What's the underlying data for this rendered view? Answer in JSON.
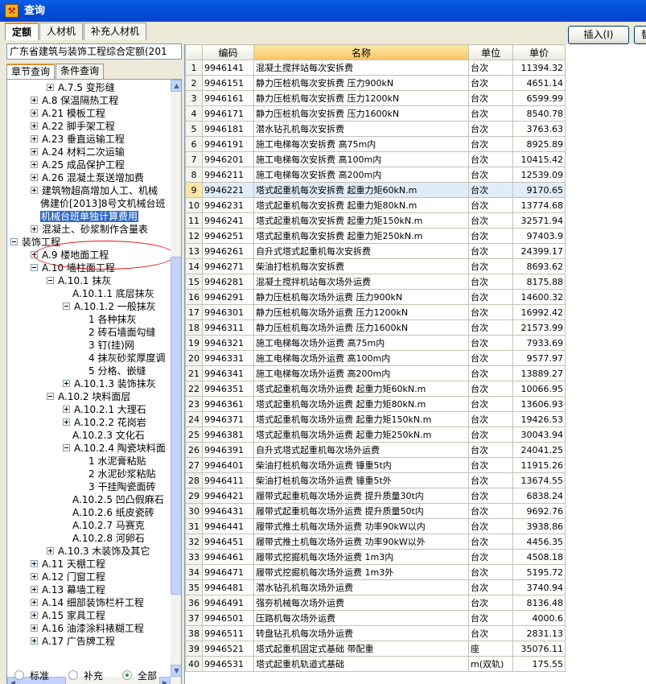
{
  "window": {
    "title": "查询"
  },
  "tabs": [
    "定额",
    "人材机",
    "补充人材机"
  ],
  "buttons": {
    "insert": "插入(I)",
    "replace": "替"
  },
  "left": {
    "quota_lib": "广东省建筑与装饰工程综合定额(201",
    "subtabs": [
      "章节查询",
      "条件查询"
    ],
    "tree": [
      {
        "label": "A.7.5 变形缝",
        "lvl": 2,
        "exp": "plus"
      },
      {
        "label": "A.8 保温隔热工程",
        "lvl": 1,
        "exp": "plus"
      },
      {
        "label": "A.21 模板工程",
        "lvl": 1,
        "exp": "plus"
      },
      {
        "label": "A.22 脚手架工程",
        "lvl": 1,
        "exp": "plus"
      },
      {
        "label": "A.23 垂直运输工程",
        "lvl": 1,
        "exp": "plus"
      },
      {
        "label": "A.24 材料二次运输",
        "lvl": 1,
        "exp": "plus"
      },
      {
        "label": "A.25 成品保护工程",
        "lvl": 1,
        "exp": "plus"
      },
      {
        "label": "A.26 混凝土泵送增加费",
        "lvl": 1,
        "exp": "plus"
      },
      {
        "label": "建筑物超高增加人工、机械",
        "lvl": 1,
        "exp": "plus"
      },
      {
        "label": "佛建价[2013]8号文机械台班",
        "lvl": 1,
        "exp": "none"
      },
      {
        "label": "机械台班单独计算费用",
        "lvl": 1,
        "exp": "none",
        "selected": true
      },
      {
        "label": "混凝土、砂浆制作含量表",
        "lvl": 1,
        "exp": "plus"
      },
      {
        "label": "装饰工程",
        "lvl": 0,
        "exp": "minus"
      },
      {
        "label": "A.9 楼地面工程",
        "lvl": 1,
        "exp": "plus"
      },
      {
        "label": "A.10 墙柱面工程",
        "lvl": 1,
        "exp": "minus"
      },
      {
        "label": "A.10.1 抹灰",
        "lvl": 2,
        "exp": "minus"
      },
      {
        "label": "A.10.1.1 底层抹灰",
        "lvl": 3,
        "exp": "none"
      },
      {
        "label": "A.10.1.2 一般抹灰",
        "lvl": 3,
        "exp": "minus"
      },
      {
        "label": "1 各种抹灰",
        "lvl": 4,
        "exp": "none"
      },
      {
        "label": "2 砖石墙面勾缝",
        "lvl": 4,
        "exp": "none"
      },
      {
        "label": "3 钉(挂)网",
        "lvl": 4,
        "exp": "none"
      },
      {
        "label": "4 抹灰砂浆厚度调",
        "lvl": 4,
        "exp": "none"
      },
      {
        "label": "5 分格、嵌缝",
        "lvl": 4,
        "exp": "none"
      },
      {
        "label": "A.10.1.3 装饰抹灰",
        "lvl": 3,
        "exp": "plus"
      },
      {
        "label": "A.10.2 块料面层",
        "lvl": 2,
        "exp": "minus"
      },
      {
        "label": "A.10.2.1 大理石",
        "lvl": 3,
        "exp": "plus"
      },
      {
        "label": "A.10.2.2 花岗岩",
        "lvl": 3,
        "exp": "plus"
      },
      {
        "label": "A.10.2.3 文化石",
        "lvl": 3,
        "exp": "none"
      },
      {
        "label": "A.10.2.4 陶瓷块料面",
        "lvl": 3,
        "exp": "minus"
      },
      {
        "label": "1 水泥膏粘贴",
        "lvl": 4,
        "exp": "none"
      },
      {
        "label": "2 水泥砂浆粘贴",
        "lvl": 4,
        "exp": "none"
      },
      {
        "label": "3 干挂陶瓷面砖",
        "lvl": 4,
        "exp": "none"
      },
      {
        "label": "A.10.2.5 凹凸假麻石",
        "lvl": 3,
        "exp": "none"
      },
      {
        "label": "A.10.2.6 纸皮瓷砖",
        "lvl": 3,
        "exp": "none"
      },
      {
        "label": "A.10.2.7 马赛克",
        "lvl": 3,
        "exp": "none"
      },
      {
        "label": "A.10.2.8 河卵石",
        "lvl": 3,
        "exp": "none"
      },
      {
        "label": "A.10.3 木装饰及其它",
        "lvl": 2,
        "exp": "plus"
      },
      {
        "label": "A.11 天棚工程",
        "lvl": 1,
        "exp": "plus"
      },
      {
        "label": "A.12 门窗工程",
        "lvl": 1,
        "exp": "plus"
      },
      {
        "label": "A.13 幕墙工程",
        "lvl": 1,
        "exp": "plus"
      },
      {
        "label": "A.14 细部装饰栏杆工程",
        "lvl": 1,
        "exp": "plus"
      },
      {
        "label": "A.15 家具工程",
        "lvl": 1,
        "exp": "plus"
      },
      {
        "label": "A.16 油漆涂料裱糊工程",
        "lvl": 1,
        "exp": "plus"
      },
      {
        "label": "A.17 广告牌工程",
        "lvl": 1,
        "exp": "plus"
      }
    ],
    "radios": [
      "标准",
      "补充",
      "全部"
    ]
  },
  "grid": {
    "columns": [
      "编码",
      "名称",
      "单位",
      "单价"
    ],
    "rows": [
      [
        "9946141",
        "混凝土搅拌站每次安拆费",
        "台次",
        "11394.32"
      ],
      [
        "9946151",
        "静力压桩机每次安拆费 压力900kN",
        "台次",
        "4651.14"
      ],
      [
        "9946161",
        "静力压桩机每次安拆费 压力1200kN",
        "台次",
        "6599.99"
      ],
      [
        "9946171",
        "静力压桩机每次安拆费 压力1600kN",
        "台次",
        "8540.78"
      ],
      [
        "9946181",
        "潜水钻孔机每次安拆费",
        "台次",
        "3763.63"
      ],
      [
        "9946191",
        "施工电梯每次安拆费 高75m内",
        "台次",
        "8925.89"
      ],
      [
        "9946201",
        "施工电梯每次安拆费 高100m内",
        "台次",
        "10415.42"
      ],
      [
        "9946211",
        "施工电梯每次安拆费 高200m内",
        "台次",
        "12539.09"
      ],
      [
        "9946221",
        "塔式起重机每次安拆费 起重力矩60kN.m",
        "台次",
        "9170.65"
      ],
      [
        "9946231",
        "塔式起重机每次安拆费 起重力矩80kN.m",
        "台次",
        "13774.68"
      ],
      [
        "9946241",
        "塔式起重机每次安拆费 起重力矩150kN.m",
        "台次",
        "32571.94"
      ],
      [
        "9946251",
        "塔式起重机每次安拆费 起重力矩250kN.m",
        "台次",
        "97403.9"
      ],
      [
        "9946261",
        "自升式塔式起重机每次安拆费",
        "台次",
        "24399.17"
      ],
      [
        "9946271",
        "柴油打桩机每次安拆费",
        "台次",
        "8693.62"
      ],
      [
        "9946281",
        "混凝土搅拌机站每次场外运费",
        "台次",
        "8175.88"
      ],
      [
        "9946291",
        "静力压桩机每次场外运费 压力900kN",
        "台次",
        "14600.32"
      ],
      [
        "9946301",
        "静力压桩机每次场外运费 压力1200kN",
        "台次",
        "16992.42"
      ],
      [
        "9946311",
        "静力压桩机每次场外运费 压力1600kN",
        "台次",
        "21573.99"
      ],
      [
        "9946321",
        "施工电梯每次场外运费 高75m内",
        "台次",
        "7933.69"
      ],
      [
        "9946331",
        "施工电梯每次场外运费 高100m内",
        "台次",
        "9577.97"
      ],
      [
        "9946341",
        "施工电梯每次场外运费 高200m内",
        "台次",
        "13889.27"
      ],
      [
        "9946351",
        "塔式起重机每次场外运费 起重力矩60kN.m",
        "台次",
        "10066.95"
      ],
      [
        "9946361",
        "塔式起重机每次场外运费 起重力矩80kN.m",
        "台次",
        "13606.93"
      ],
      [
        "9946371",
        "塔式起重机每次场外运费 起重力矩150kN.m",
        "台次",
        "19426.53"
      ],
      [
        "9946381",
        "塔式起重机每次场外运费 起重力矩250kN.m",
        "台次",
        "30043.94"
      ],
      [
        "9946391",
        "自升式塔式起重机每次场外运费",
        "台次",
        "24041.25"
      ],
      [
        "9946401",
        "柴油打桩机每次场外运费 锤重5t内",
        "台次",
        "11915.26"
      ],
      [
        "9946411",
        "柴油打桩机每次场外运费 锤重5t外",
        "台次",
        "13674.55"
      ],
      [
        "9946421",
        "履带式起重机每次场外运费 提升质量30t内",
        "台次",
        "6838.24"
      ],
      [
        "9946431",
        "履带式起重机每次场外运费 提升质量50t内",
        "台次",
        "9692.76"
      ],
      [
        "9946441",
        "履带式推土机每次场外运费 功率90kW以内",
        "台次",
        "3938.86"
      ],
      [
        "9946451",
        "履带式推土机每次场外运费 功率90kW以外",
        "台次",
        "4456.35"
      ],
      [
        "9946461",
        "履带式挖掘机每次场外运费 1m3内",
        "台次",
        "4508.18"
      ],
      [
        "9946471",
        "履带式挖掘机每次场外运费 1m3外",
        "台次",
        "5195.72"
      ],
      [
        "9946481",
        "潜水钻孔机每次场外运费",
        "台次",
        "3740.94"
      ],
      [
        "9946491",
        "强夯机械每次场外运费",
        "台次",
        "8136.48"
      ],
      [
        "9946501",
        "压路机每次场外运费",
        "台次",
        "4000.6"
      ],
      [
        "9946511",
        "转盘钻孔机每次场外运费",
        "台次",
        "2831.13"
      ],
      [
        "9946521",
        "塔式起重机固定式基础 带配重",
        "座",
        "35076.11"
      ],
      [
        "9946531",
        "塔式起重机轨道式基础",
        "m(双轨)",
        "175.55"
      ]
    ],
    "highlight_row": 9
  }
}
